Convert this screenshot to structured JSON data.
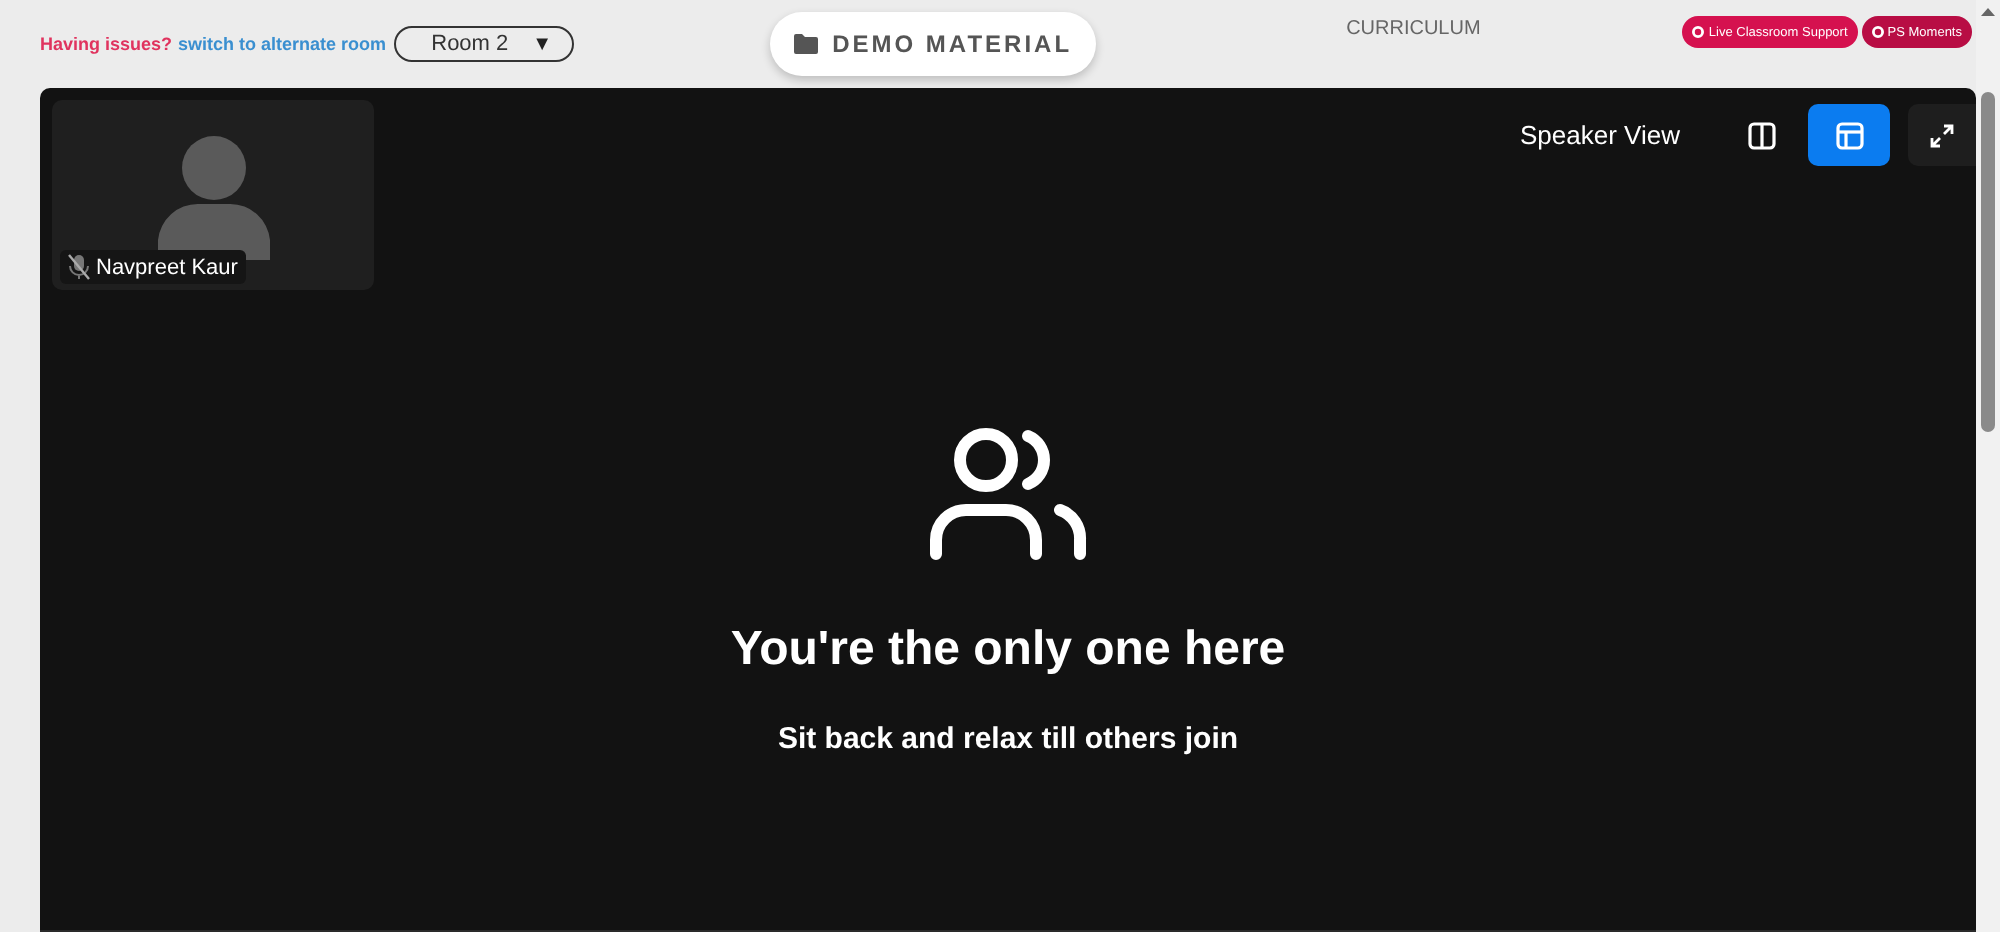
{
  "header": {
    "issue_label": "Having issues?",
    "switch_link": "switch to alternate room",
    "room_select": {
      "value": "Room 2",
      "caret": "▼"
    },
    "demo_button": "DEMO MATERIAL",
    "curriculum_link": "CURRICULUM",
    "pill_buttons": [
      "Live Classroom Support",
      "PS Moments"
    ]
  },
  "meeting": {
    "participant": {
      "name": "Navpreet Kaur",
      "muted": true
    },
    "view_label": "Speaker View",
    "view_buttons": [
      {
        "kind": "split",
        "selected": false
      },
      {
        "kind": "sidebar",
        "selected": true
      }
    ],
    "empty_title": "You're the only one here",
    "empty_subtitle": "Sit back and relax till others join"
  }
}
